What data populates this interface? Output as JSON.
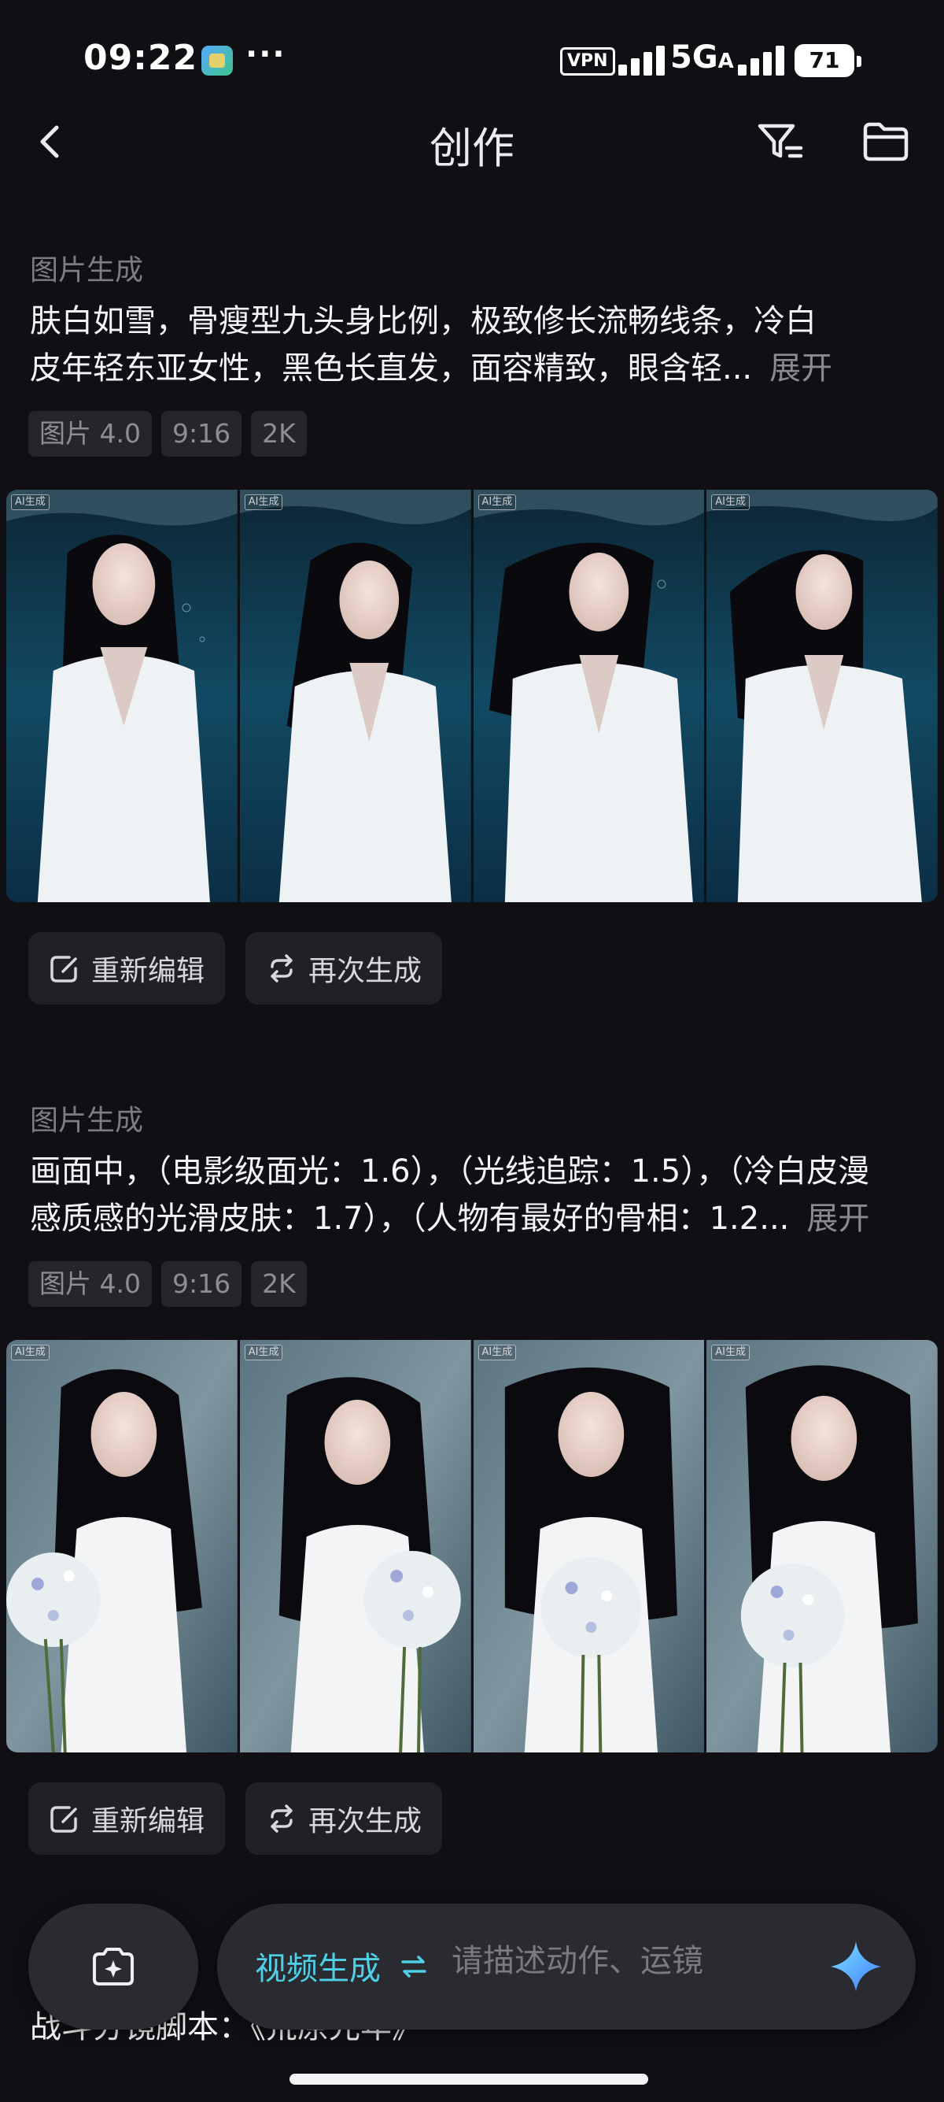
{
  "status_bar": {
    "time": "09:22",
    "dots": "···",
    "vpn": "VPN",
    "network": "5G",
    "network_sub": "A",
    "battery": "71"
  },
  "nav": {
    "title": "创作",
    "back_icon": "chevron-left-icon",
    "filter_icon": "filter-icon",
    "folder_icon": "folder-icon"
  },
  "cards": [
    {
      "type": "图片生成",
      "prompt_line1": "肤白如雪，骨瘦型九头身比例，极致修长流畅线条，冷白",
      "prompt_line2": "皮年轻东亚女性，黑色长直发，面容精致，眼含轻...",
      "expand": "展开",
      "tags": [
        "图片 4.0",
        "9:16",
        "2K"
      ],
      "image_badge": "AI生成",
      "actions": {
        "edit": "重新编辑",
        "regenerate": "再次生成"
      }
    },
    {
      "type": "图片生成",
      "prompt_line1": "画面中，（电影级面光：1.6），（光线追踪：1.5），（冷白皮漫",
      "prompt_line2": "感质感的光滑皮肤：1.7），（人物有最好的骨相：1.2...",
      "expand": "展开",
      "tags": [
        "图片 4.0",
        "9:16",
        "2K"
      ],
      "image_badge": "AI生成",
      "actions": {
        "edit": "重新编辑",
        "regenerate": "再次生成"
      }
    }
  ],
  "peek_text": "战斗分镜脚本：《荒原光年》",
  "composer": {
    "mode": "视频生成",
    "placeholder": "请描述动作、运镜",
    "camera_icon": "camera-sparkle-icon",
    "swap_icon": "swap-icon",
    "send_icon": "sparkle-icon"
  },
  "colors": {
    "background": "#101014",
    "accent": "#4fd0e6",
    "chip": "#25252b",
    "button": "#202026"
  }
}
